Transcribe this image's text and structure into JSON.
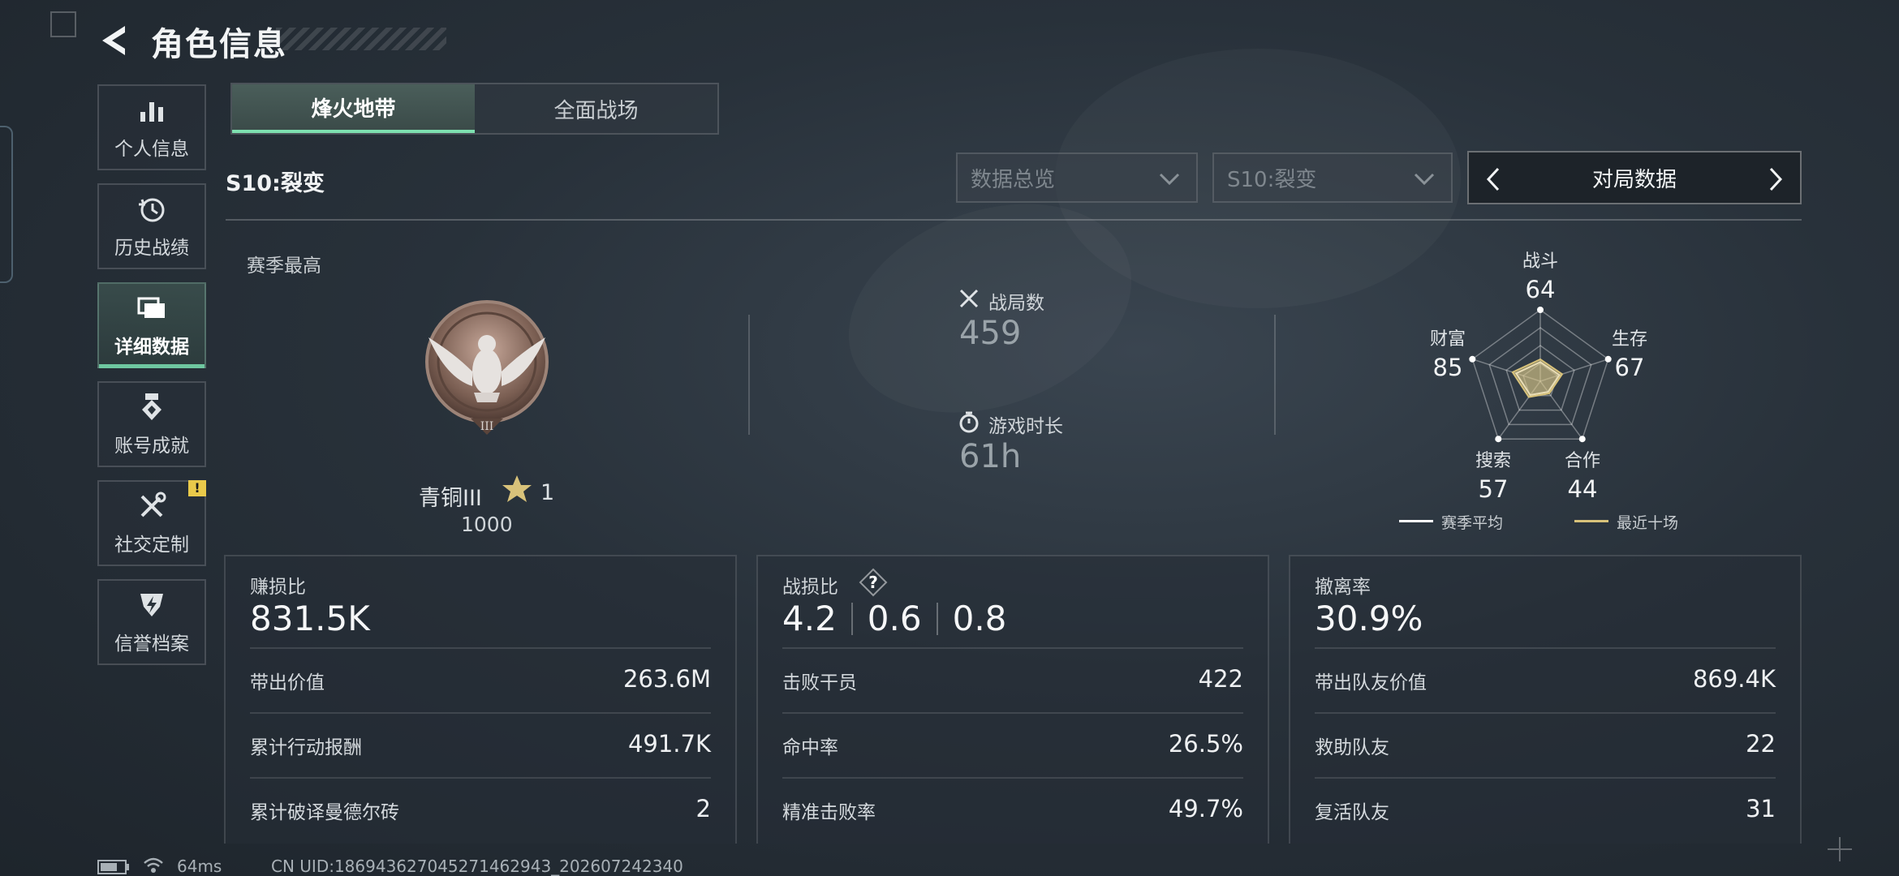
{
  "header": {
    "title": "角色信息"
  },
  "sidebar": {
    "items": [
      {
        "label": "个人信息",
        "icon": "bar-chart-icon"
      },
      {
        "label": "历史战绩",
        "icon": "history-clock-icon"
      },
      {
        "label": "详细数据",
        "icon": "folders-icon",
        "active": true
      },
      {
        "label": "账号成就",
        "icon": "medal-icon"
      },
      {
        "label": "社交定制",
        "icon": "tools-icon",
        "badge": "!"
      },
      {
        "label": "信誉档案",
        "icon": "shield-bolt-icon"
      }
    ]
  },
  "tabs": [
    {
      "label": "烽火地带",
      "active": true
    },
    {
      "label": "全面战场",
      "active": false
    }
  ],
  "season": {
    "label": "S10:裂变"
  },
  "filters": {
    "overview": "数据总览",
    "season": "S10:裂变",
    "selector": "对局数据"
  },
  "summary": {
    "season_best_label": "赛季最高",
    "rank_name": "青铜III",
    "rank_stars": "1",
    "rank_score": "1000",
    "matches_label": "战局数",
    "matches_value": "459",
    "playtime_label": "游戏时长",
    "playtime_value": "61h"
  },
  "radar": {
    "axes": [
      {
        "label": "战斗",
        "value": "64"
      },
      {
        "label": "生存",
        "value": "67"
      },
      {
        "label": "合作",
        "value": "44"
      },
      {
        "label": "搜索",
        "value": "57"
      },
      {
        "label": "财富",
        "value": "85"
      }
    ],
    "legend": {
      "season_avg": "赛季平均",
      "recent": "最近十场"
    },
    "colors": {
      "season_avg": "#ffffff",
      "recent": "#d8c27a"
    }
  },
  "cards": {
    "profit": {
      "label": "赚损比",
      "value": "831.5K",
      "rows": [
        {
          "k": "带出价值",
          "v": "263.6M"
        },
        {
          "k": "累计行动报酬",
          "v": "491.7K"
        },
        {
          "k": "累计破译曼德尔砖",
          "v": "2"
        }
      ]
    },
    "combat": {
      "label": "战损比",
      "help": "?",
      "values": [
        "4.2",
        "0.6",
        "0.8"
      ],
      "rows": [
        {
          "k": "击败干员",
          "v": "422"
        },
        {
          "k": "命中率",
          "v": "26.5%"
        },
        {
          "k": "精准击败率",
          "v": "49.7%"
        }
      ]
    },
    "extract": {
      "label": "撤离率",
      "value": "30.9%",
      "rows": [
        {
          "k": "带出队友价值",
          "v": "869.4K"
        },
        {
          "k": "救助队友",
          "v": "22"
        },
        {
          "k": "复活队友",
          "v": "31"
        }
      ]
    }
  },
  "footer": {
    "ping": "64ms",
    "uid": "CN UID:1869436270452714629​43_202607242340"
  }
}
